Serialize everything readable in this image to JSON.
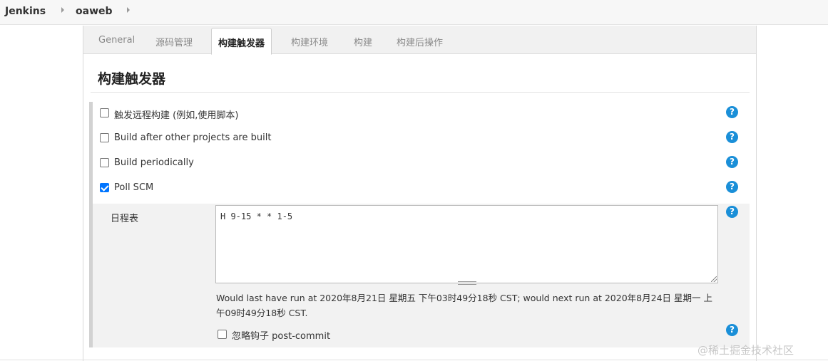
{
  "breadcrumb": {
    "items": [
      {
        "label": "Jenkins"
      },
      {
        "label": "oaweb"
      }
    ]
  },
  "tabs": [
    {
      "label": "General",
      "active": false
    },
    {
      "label": "源码管理",
      "active": false
    },
    {
      "label": "构建触发器",
      "active": true
    },
    {
      "label": "构建环境",
      "active": false
    },
    {
      "label": "构建",
      "active": false
    },
    {
      "label": "构建后操作",
      "active": false
    }
  ],
  "section": {
    "title": "构建触发器"
  },
  "triggers": [
    {
      "label": "触发远程构建 (例如,使用脚本)",
      "checked": false
    },
    {
      "label": "Build after other projects are built",
      "checked": false
    },
    {
      "label": "Build periodically",
      "checked": false
    },
    {
      "label": "Poll SCM",
      "checked": true
    }
  ],
  "poll_scm": {
    "schedule_label": "日程表",
    "schedule_value": "H 9-15 * * 1-5",
    "run_info": "Would last have run at 2020年8月21日 星期五 下午03时49分18秒 CST; would next run at 2020年8月24日 星期一 上午09时49分18秒 CST.",
    "ignore_hook_label": "忽略钩子 post-commit",
    "ignore_hook_checked": false
  },
  "help_icon_glyph": "?",
  "watermark": "@稀土掘金技术社区",
  "colors": {
    "accent": "#1a8fd8",
    "checkbox_checked": "#0075ff"
  }
}
